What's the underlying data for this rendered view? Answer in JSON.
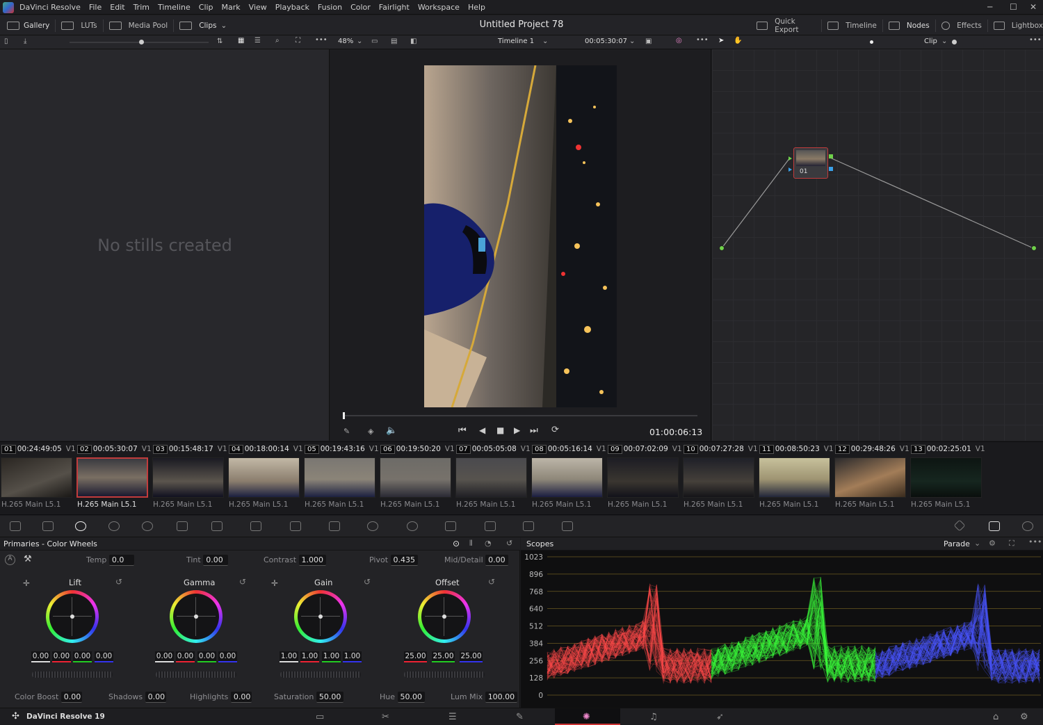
{
  "menubar": {
    "app_name": "DaVinci Resolve",
    "items": [
      "File",
      "Edit",
      "Trim",
      "Timeline",
      "Clip",
      "Mark",
      "View",
      "Playback",
      "Fusion",
      "Color",
      "Fairlight",
      "Workspace",
      "Help"
    ]
  },
  "toolbar": {
    "gallery": "Gallery",
    "luts": "LUTs",
    "media_pool": "Media Pool",
    "clips": "Clips",
    "project_title": "Untitled Project 78",
    "quick_export": "Quick Export",
    "timeline": "Timeline",
    "nodes": "Nodes",
    "effects": "Effects",
    "lightbox": "Lightbox"
  },
  "viewer": {
    "zoom": "48%",
    "timeline_name": "Timeline 1",
    "clip_timecode": "00:05:30:07",
    "playhead_timecode": "01:00:06:13",
    "node_mode": "Clip"
  },
  "gallery": {
    "empty_message": "No stills created"
  },
  "nodes": {
    "node_label": "01"
  },
  "clips": [
    {
      "num": "01",
      "tc": "00:24:49:05",
      "track": "V1",
      "codec": "H.265 Main L5.1"
    },
    {
      "num": "02",
      "tc": "00:05:30:07",
      "track": "V1",
      "codec": "H.265 Main L5.1",
      "selected": true
    },
    {
      "num": "03",
      "tc": "00:15:48:17",
      "track": "V1",
      "codec": "H.265 Main L5.1"
    },
    {
      "num": "04",
      "tc": "00:18:00:14",
      "track": "V1",
      "codec": "H.265 Main L5.1"
    },
    {
      "num": "05",
      "tc": "00:19:43:16",
      "track": "V1",
      "codec": "H.265 Main L5.1"
    },
    {
      "num": "06",
      "tc": "00:19:50:20",
      "track": "V1",
      "codec": "H.265 Main L5.1"
    },
    {
      "num": "07",
      "tc": "00:05:05:08",
      "track": "V1",
      "codec": "H.265 Main L5.1"
    },
    {
      "num": "08",
      "tc": "00:05:16:14",
      "track": "V1",
      "codec": "H.265 Main L5.1"
    },
    {
      "num": "09",
      "tc": "00:07:02:09",
      "track": "V1",
      "codec": "H.265 Main L5.1"
    },
    {
      "num": "10",
      "tc": "00:07:27:28",
      "track": "V1",
      "codec": "H.265 Main L5.1"
    },
    {
      "num": "11",
      "tc": "00:08:50:23",
      "track": "V1",
      "codec": "H.265 Main L5.1"
    },
    {
      "num": "12",
      "tc": "00:29:48:26",
      "track": "V1",
      "codec": "H.265 Main L5.1"
    },
    {
      "num": "13",
      "tc": "00:02:25:01",
      "track": "V1",
      "codec": "H.265 Main L5.1"
    }
  ],
  "primaries": {
    "title": "Primaries - Color Wheels",
    "temp_label": "Temp",
    "temp": "0.0",
    "tint_label": "Tint",
    "tint": "0.00",
    "contrast_label": "Contrast",
    "contrast": "1.000",
    "pivot_label": "Pivot",
    "pivot": "0.435",
    "middetail_label": "Mid/Detail",
    "middetail": "0.00",
    "wheels": [
      {
        "name": "Lift",
        "values": [
          "0.00",
          "0.00",
          "0.00",
          "0.00"
        ]
      },
      {
        "name": "Gamma",
        "values": [
          "0.00",
          "0.00",
          "0.00",
          "0.00"
        ]
      },
      {
        "name": "Gain",
        "values": [
          "1.00",
          "1.00",
          "1.00",
          "1.00"
        ]
      },
      {
        "name": "Offset",
        "values": [
          "25.00",
          "25.00",
          "25.00"
        ]
      }
    ],
    "colorboost_label": "Color Boost",
    "colorboost": "0.00",
    "shadows_label": "Shadows",
    "shadows": "0.00",
    "highlights_label": "Highlights",
    "highlights": "0.00",
    "saturation_label": "Saturation",
    "saturation": "50.00",
    "hue_label": "Hue",
    "hue": "50.00",
    "lummix_label": "Lum Mix",
    "lummix": "100.00"
  },
  "scopes": {
    "title": "Scopes",
    "mode": "Parade",
    "scale": [
      "1023",
      "896",
      "768",
      "640",
      "512",
      "384",
      "256",
      "128",
      "0"
    ],
    "colors": {
      "red": "#ff4a4a",
      "green": "#3dff3d",
      "blue": "#4a55ff"
    }
  },
  "footer": {
    "app_version": "DaVinci Resolve 19"
  }
}
